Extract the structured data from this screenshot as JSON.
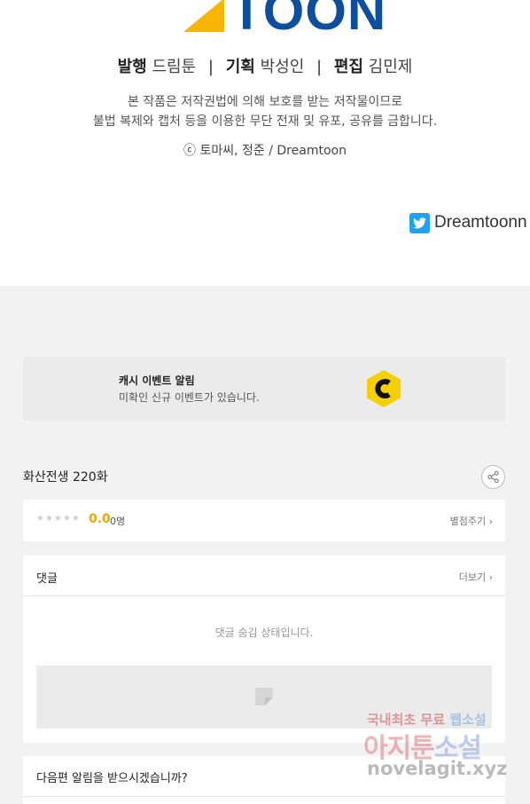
{
  "credits": {
    "logo_text": "TOON",
    "staff": [
      {
        "role": "발행",
        "name": "드림툰"
      },
      {
        "role": "기획",
        "name": "박성인"
      },
      {
        "role": "편집",
        "name": "김민제"
      }
    ],
    "separator": "|",
    "notice_line1": "본 작품은 저작권법에 의해 보호를 받는 저작물이므로",
    "notice_line2": "불법 복제와 캡처 등을 이용한 무단 전재 및 유포, 공유를 금합니다.",
    "copyright": "ⓒ 토마씨, 정준 / Dreamtoon",
    "twitter_handle": "Dreamtoonn"
  },
  "event": {
    "title": "캐시 이벤트 알림",
    "subtitle": "미확인 신규 이벤트가 있습니다.",
    "coin_letter": "C"
  },
  "episode": {
    "title": "화산전생 220화"
  },
  "rating": {
    "stars": "★★★★★",
    "score": "0.0",
    "count": "0명",
    "rate_link": "별점주기 ›"
  },
  "comments": {
    "title": "댓글",
    "more": "더보기 ›",
    "hidden_message": "댓글 숨김 상태입니다."
  },
  "notify": {
    "question": "다음편 알림을 받으시겠습니까?"
  },
  "watermark": {
    "line1": "국내최초 무료 ",
    "line1_hl": "웹소설",
    "line2": "아지툰",
    "line2_hl": "소설",
    "line3": "novelagit.xyz"
  },
  "colors": {
    "brand_blue": "#0d4e9e",
    "brand_yellow": "#f7b500",
    "score_orange": "#f0a800",
    "twitter_blue": "#1da1f2",
    "coin_yellow": "#f5d000"
  }
}
